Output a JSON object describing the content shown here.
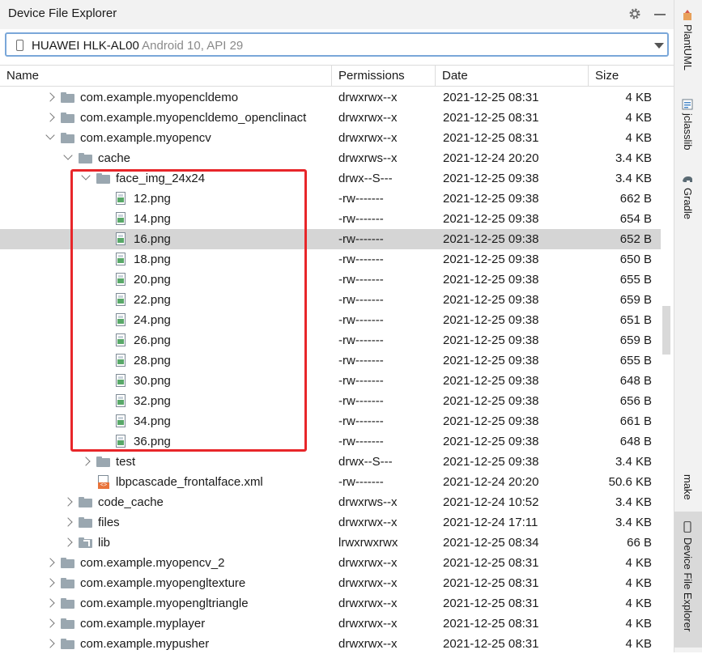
{
  "panel": {
    "title": "Device File Explorer",
    "settings_icon": "gear-icon",
    "minimize_icon": "minimize-icon"
  },
  "device": {
    "name": "HUAWEI HLK-AL00",
    "detail": "Android 10, API 29"
  },
  "columns": {
    "name": "Name",
    "permissions": "Permissions",
    "date": "Date",
    "size": "Size"
  },
  "rows": [
    {
      "name": "com.example.myopencldemo",
      "permissions": "drwxrwx--x",
      "date": "2021-12-25 08:31",
      "size": "4 KB",
      "level": 0,
      "kind": "folder",
      "toggle": "collapsed"
    },
    {
      "name": "com.example.myopencldemo_openclinact",
      "permissions": "drwxrwx--x",
      "date": "2021-12-25 08:31",
      "size": "4 KB",
      "level": 0,
      "kind": "folder",
      "toggle": "collapsed"
    },
    {
      "name": "com.example.myopencv",
      "permissions": "drwxrwx--x",
      "date": "2021-12-25 08:31",
      "size": "4 KB",
      "level": 0,
      "kind": "folder",
      "toggle": "expanded"
    },
    {
      "name": "cache",
      "permissions": "drwxrws--x",
      "date": "2021-12-24 20:20",
      "size": "3.4 KB",
      "level": 1,
      "kind": "folder",
      "toggle": "expanded"
    },
    {
      "name": "face_img_24x24",
      "permissions": "drwx--S---",
      "date": "2021-12-25 09:38",
      "size": "3.4 KB",
      "level": 2,
      "kind": "folder",
      "toggle": "expanded"
    },
    {
      "name": "12.png",
      "permissions": "-rw-------",
      "date": "2021-12-25 09:38",
      "size": "662 B",
      "level": 3,
      "kind": "png"
    },
    {
      "name": "14.png",
      "permissions": "-rw-------",
      "date": "2021-12-25 09:38",
      "size": "654 B",
      "level": 3,
      "kind": "png"
    },
    {
      "name": "16.png",
      "permissions": "-rw-------",
      "date": "2021-12-25 09:38",
      "size": "652 B",
      "level": 3,
      "kind": "png",
      "selected": true
    },
    {
      "name": "18.png",
      "permissions": "-rw-------",
      "date": "2021-12-25 09:38",
      "size": "650 B",
      "level": 3,
      "kind": "png"
    },
    {
      "name": "20.png",
      "permissions": "-rw-------",
      "date": "2021-12-25 09:38",
      "size": "655 B",
      "level": 3,
      "kind": "png"
    },
    {
      "name": "22.png",
      "permissions": "-rw-------",
      "date": "2021-12-25 09:38",
      "size": "659 B",
      "level": 3,
      "kind": "png"
    },
    {
      "name": "24.png",
      "permissions": "-rw-------",
      "date": "2021-12-25 09:38",
      "size": "651 B",
      "level": 3,
      "kind": "png"
    },
    {
      "name": "26.png",
      "permissions": "-rw-------",
      "date": "2021-12-25 09:38",
      "size": "659 B",
      "level": 3,
      "kind": "png"
    },
    {
      "name": "28.png",
      "permissions": "-rw-------",
      "date": "2021-12-25 09:38",
      "size": "655 B",
      "level": 3,
      "kind": "png"
    },
    {
      "name": "30.png",
      "permissions": "-rw-------",
      "date": "2021-12-25 09:38",
      "size": "648 B",
      "level": 3,
      "kind": "png"
    },
    {
      "name": "32.png",
      "permissions": "-rw-------",
      "date": "2021-12-25 09:38",
      "size": "656 B",
      "level": 3,
      "kind": "png"
    },
    {
      "name": "34.png",
      "permissions": "-rw-------",
      "date": "2021-12-25 09:38",
      "size": "661 B",
      "level": 3,
      "kind": "png"
    },
    {
      "name": "36.png",
      "permissions": "-rw-------",
      "date": "2021-12-25 09:38",
      "size": "648 B",
      "level": 3,
      "kind": "png"
    },
    {
      "name": "test",
      "permissions": "drwx--S---",
      "date": "2021-12-25 09:38",
      "size": "3.4 KB",
      "level": 2,
      "kind": "folder",
      "toggle": "collapsed"
    },
    {
      "name": "lbpcascade_frontalface.xml",
      "permissions": "-rw-------",
      "date": "2021-12-24 20:20",
      "size": "50.6 KB",
      "level": 2,
      "kind": "xml"
    },
    {
      "name": "code_cache",
      "permissions": "drwxrws--x",
      "date": "2021-12-24 10:52",
      "size": "3.4 KB",
      "level": 1,
      "kind": "folder",
      "toggle": "collapsed"
    },
    {
      "name": "files",
      "permissions": "drwxrwx--x",
      "date": "2021-12-24 17:11",
      "size": "3.4 KB",
      "level": 1,
      "kind": "folder",
      "toggle": "collapsed"
    },
    {
      "name": "lib",
      "permissions": "lrwxrwxrwx",
      "date": "2021-12-25 08:34",
      "size": "66 B",
      "level": 1,
      "kind": "link",
      "toggle": "collapsed"
    },
    {
      "name": "com.example.myopencv_2",
      "permissions": "drwxrwx--x",
      "date": "2021-12-25 08:31",
      "size": "4 KB",
      "level": 0,
      "kind": "folder",
      "toggle": "collapsed"
    },
    {
      "name": "com.example.myopengltexture",
      "permissions": "drwxrwx--x",
      "date": "2021-12-25 08:31",
      "size": "4 KB",
      "level": 0,
      "kind": "folder",
      "toggle": "collapsed"
    },
    {
      "name": "com.example.myopengltriangle",
      "permissions": "drwxrwx--x",
      "date": "2021-12-25 08:31",
      "size": "4 KB",
      "level": 0,
      "kind": "folder",
      "toggle": "collapsed"
    },
    {
      "name": "com.example.myplayer",
      "permissions": "drwxrwx--x",
      "date": "2021-12-25 08:31",
      "size": "4 KB",
      "level": 0,
      "kind": "folder",
      "toggle": "collapsed"
    },
    {
      "name": "com.example.mypusher",
      "permissions": "drwxrwx--x",
      "date": "2021-12-25 08:31",
      "size": "4 KB",
      "level": 0,
      "kind": "folder",
      "toggle": "collapsed"
    }
  ],
  "sidebar": {
    "tabs": [
      {
        "label": "PlantUML",
        "icon": "plantuml-icon"
      },
      {
        "label": "jclasslib",
        "icon": "jclasslib-icon"
      },
      {
        "label": "Gradle",
        "icon": "gradle-icon"
      },
      {
        "label": "make",
        "icon": ""
      },
      {
        "label": "Device File Explorer",
        "icon": "device-icon",
        "active": true
      }
    ]
  },
  "colors": {
    "accent": "#7aa7d9",
    "annotation_box": "#e8262a",
    "selected_row": "#d5d5d5",
    "folder": "#9aa7b0"
  }
}
